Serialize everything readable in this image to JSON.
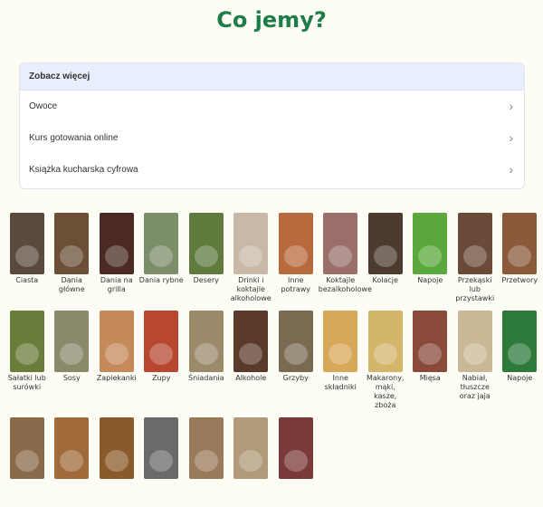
{
  "page": {
    "title": "Co jemy?"
  },
  "see_more": {
    "header": "Zobacz więcej",
    "items": [
      {
        "label": "Owoce"
      },
      {
        "label": "Kurs gotowania online"
      },
      {
        "label": "Książka kucharska cyfrowa"
      }
    ]
  },
  "categories": [
    {
      "label": "Ciasta",
      "color": "#5a4a3d"
    },
    {
      "label": "Dania główne",
      "color": "#6b4f36"
    },
    {
      "label": "Dania na grilla",
      "color": "#4a2a22"
    },
    {
      "label": "Dania rybne",
      "color": "#7c8d6a"
    },
    {
      "label": "Desery",
      "color": "#5e7a3c"
    },
    {
      "label": "Drinki i koktajle alkoholowe",
      "color": "#c9b8a8"
    },
    {
      "label": "Inne potrawy",
      "color": "#b76a3e"
    },
    {
      "label": "Koktajle bezalkoholowe",
      "color": "#9a6f6a"
    },
    {
      "label": "Kolacje",
      "color": "#4d3b2e"
    },
    {
      "label": "Napoje",
      "color": "#5aa83c"
    },
    {
      "label": "Przekąski lub przystawki",
      "color": "#6a4a38"
    },
    {
      "label": "Przetwory",
      "color": "#8a5a3a"
    },
    {
      "label": "Sałatki lub surówki",
      "color": "#6a7d3a"
    },
    {
      "label": "Sosy",
      "color": "#8a8a6a"
    },
    {
      "label": "Zapiekanki",
      "color": "#c48a5a"
    },
    {
      "label": "Zupy",
      "color": "#b7472f"
    },
    {
      "label": "Śniadania",
      "color": "#9a8a6a"
    },
    {
      "label": "Alkohole",
      "color": "#5a3a2a"
    },
    {
      "label": "Grzyby",
      "color": "#7a6a52"
    },
    {
      "label": "Inne składniki",
      "color": "#d8a85a"
    },
    {
      "label": "Makarony, mąki, kasze, zboża",
      "color": "#d4b66a"
    },
    {
      "label": "Mięsa",
      "color": "#8a4a3a"
    },
    {
      "label": "Nabiał, tłuszcze oraz jaja",
      "color": "#c8b896"
    },
    {
      "label": "Napoje",
      "color": "#2e7a3a"
    },
    {
      "label": "",
      "color": "#8a6a4a"
    },
    {
      "label": "",
      "color": "#a06a3a"
    },
    {
      "label": "",
      "color": "#8a5a2a"
    },
    {
      "label": "",
      "color": "#6a6a6a"
    },
    {
      "label": "",
      "color": "#9a7a5a"
    },
    {
      "label": "",
      "color": "#b09a7a"
    },
    {
      "label": "",
      "color": "#7a3a3a"
    }
  ]
}
